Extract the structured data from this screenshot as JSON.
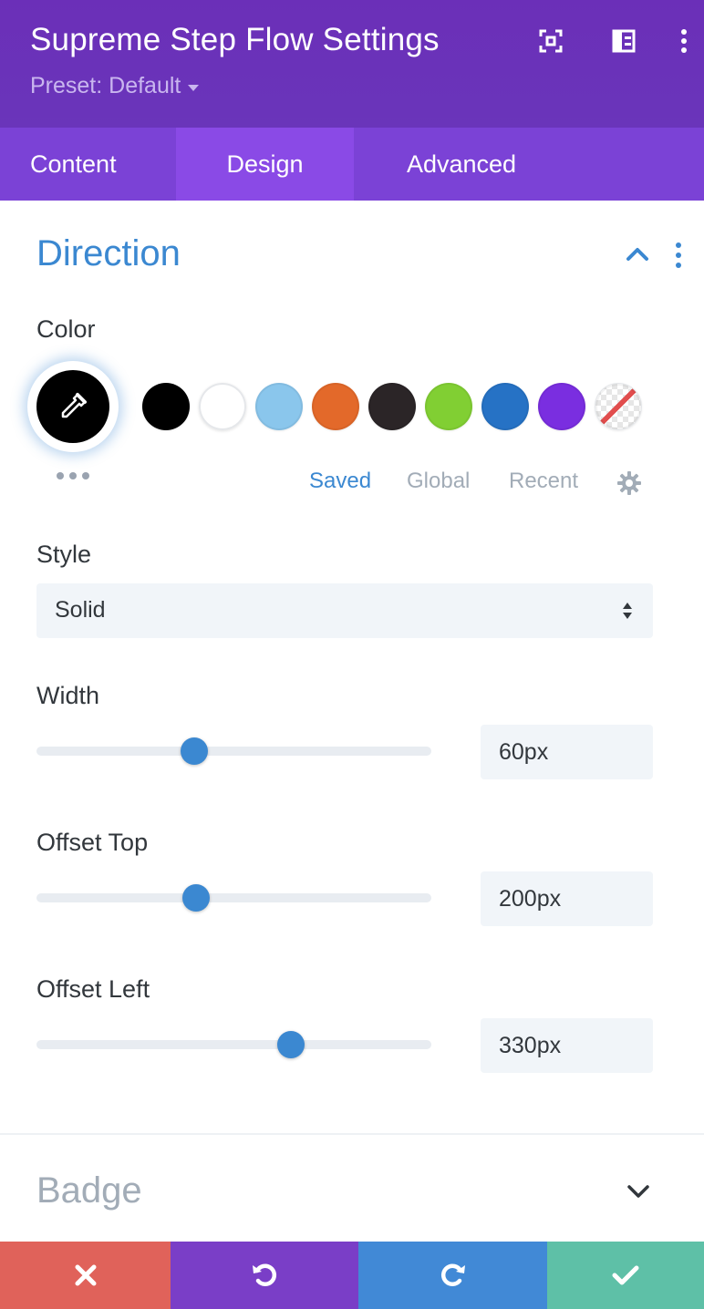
{
  "header": {
    "title": "Supreme Step Flow Settings",
    "preset_label": "Preset: Default",
    "icons": [
      "focus-icon",
      "layout-icon",
      "more-vertical-icon"
    ]
  },
  "tabs": [
    {
      "label": "Content",
      "active": false
    },
    {
      "label": "Design",
      "active": true
    },
    {
      "label": "Advanced",
      "active": false
    }
  ],
  "section": {
    "title": "Direction",
    "expanded": true
  },
  "color": {
    "label": "Color",
    "selected": "#000000",
    "swatches": [
      "#000000",
      "#ffffff",
      "#8ac6ec",
      "#e3692a",
      "#2b2527",
      "#81cf33",
      "#2672c5",
      "#7a2ee0",
      "none"
    ],
    "palette_tabs": [
      {
        "label": "Saved",
        "active": true
      },
      {
        "label": "Global",
        "active": false
      },
      {
        "label": "Recent",
        "active": false
      }
    ]
  },
  "style": {
    "label": "Style",
    "value": "Solid"
  },
  "width": {
    "label": "Width",
    "value": "60px",
    "slider_fraction": 0.4
  },
  "offset_top": {
    "label": "Offset Top",
    "value": "200px",
    "slider_fraction": 0.405
  },
  "offset_left": {
    "label": "Offset Left",
    "value": "330px",
    "slider_fraction": 0.645
  },
  "badge_section": {
    "title": "Badge",
    "expanded": false
  },
  "footer": {
    "buttons": [
      {
        "name": "cancel",
        "color": "#e0625a"
      },
      {
        "name": "undo",
        "color": "#7a3ec7"
      },
      {
        "name": "redo",
        "color": "#4189d6"
      },
      {
        "name": "save",
        "color": "#5ec0a7"
      }
    ]
  },
  "colors": {
    "header_bg": "#6c2eb9",
    "tabs_bg": "#7b42d6",
    "active_tab_bg": "#8a4ae6",
    "accent": "#3b88d1"
  }
}
